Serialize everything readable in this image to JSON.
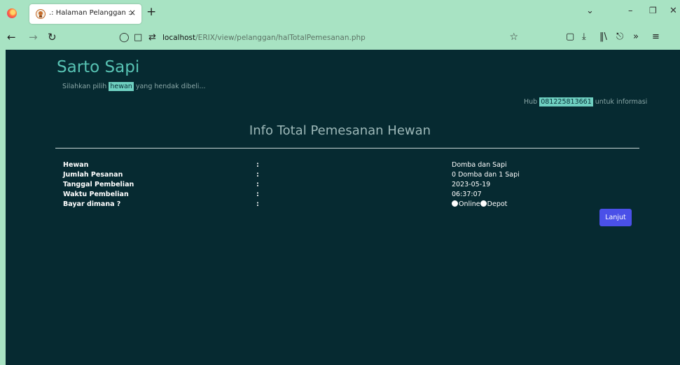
{
  "browser": {
    "tab_title": ".: Halaman Pelanggan :.",
    "tab_close": "×",
    "new_tab": "+",
    "url_host": "localhost",
    "url_path": "/ERIX/view/pelanggan/halTotalPemesanan.php"
  },
  "header": {
    "brand": "Sarto Sapi",
    "tagline_before": "Silahkan pilih ",
    "tagline_highlight": "hewan",
    "tagline_after": " yang hendak dibeli...",
    "contact_before": "Hub ",
    "contact_phone": "081225813661",
    "contact_after": " untuk informasi"
  },
  "main": {
    "heading": "Info Total Pemesanan Hewan",
    "rows": [
      {
        "label": "Hewan",
        "colon": ":",
        "value": "Domba dan Sapi"
      },
      {
        "label": "Jumlah Pesanan",
        "colon": ":",
        "value": "0 Domba dan 1 Sapi"
      },
      {
        "label": "Tanggal Pembelian",
        "colon": ":",
        "value": "2023-05-19"
      },
      {
        "label": "Waktu Pembelian",
        "colon": ":",
        "value": "06:37:07"
      },
      {
        "label": "Bayar dimana ?",
        "colon": ":"
      }
    ],
    "payment_options": [
      "Online",
      "Depot"
    ],
    "next_button": "Lanjut"
  },
  "colors": {
    "chrome": "#a8e3c3",
    "page_bg": "#062a31",
    "brand": "#57c2b3",
    "highlight": "#6fd0c1",
    "button": "#4a50e8"
  }
}
